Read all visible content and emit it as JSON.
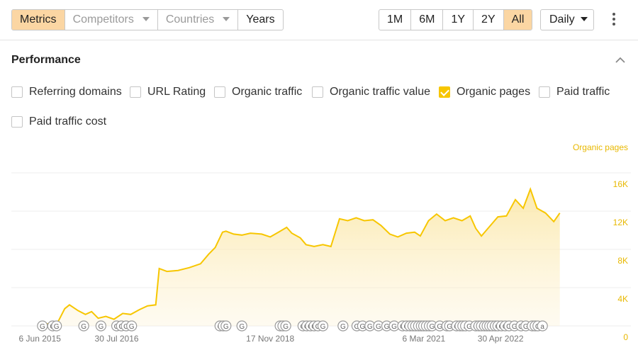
{
  "toolbar": {
    "tabs": [
      {
        "label": "Metrics",
        "state": "active"
      },
      {
        "label": "Competitors",
        "state": "disabled",
        "dropdown": true
      },
      {
        "label": "Countries",
        "state": "disabled",
        "dropdown": true
      },
      {
        "label": "Years",
        "state": "normal"
      }
    ],
    "ranges": [
      {
        "label": "1M",
        "active": false
      },
      {
        "label": "6M",
        "active": false
      },
      {
        "label": "1Y",
        "active": false
      },
      {
        "label": "2Y",
        "active": false
      },
      {
        "label": "All",
        "active": true
      }
    ],
    "interval": "Daily"
  },
  "performance": {
    "title": "Performance",
    "metrics": [
      {
        "label": "Referring domains",
        "checked": false
      },
      {
        "label": "URL Rating",
        "checked": false
      },
      {
        "label": "Organic traffic",
        "checked": false
      },
      {
        "label": "Organic traffic value",
        "checked": false
      },
      {
        "label": "Organic pages",
        "checked": true
      },
      {
        "label": "Paid traffic",
        "checked": false
      },
      {
        "label": "Paid traffic cost",
        "checked": false
      }
    ]
  },
  "colors": {
    "accent": "#f7c600",
    "active_tab": "#fbd6a3",
    "axis_label": "#e8b800"
  },
  "chart_data": {
    "type": "area",
    "series_name": "Organic pages",
    "y_ticks": [
      "16K",
      "12K",
      "8K",
      "4K",
      "0"
    ],
    "x_ticks": [
      "6 Jun 2015",
      "30 Jul 2016",
      "17 Nov 2018",
      "6 Mar 2021",
      "30 Apr 2022"
    ],
    "ylim": [
      0,
      16000
    ],
    "x_range": [
      "2015-01-01",
      "2023-10-01"
    ],
    "grid": true,
    "points": [
      [
        "2015-06-01",
        0
      ],
      [
        "2015-07-15",
        200
      ],
      [
        "2015-09-15",
        500
      ],
      [
        "2015-10-20",
        1800
      ],
      [
        "2015-11-15",
        2200
      ],
      [
        "2016-01-01",
        1600
      ],
      [
        "2016-02-10",
        1200
      ],
      [
        "2016-03-15",
        1500
      ],
      [
        "2016-04-20",
        800
      ],
      [
        "2016-06-01",
        1000
      ],
      [
        "2016-07-15",
        700
      ],
      [
        "2016-09-01",
        1300
      ],
      [
        "2016-10-15",
        1200
      ],
      [
        "2016-12-01",
        1700
      ],
      [
        "2017-01-15",
        2100
      ],
      [
        "2017-03-01",
        2200
      ],
      [
        "2017-03-20",
        6000
      ],
      [
        "2017-05-01",
        5700
      ],
      [
        "2017-07-01",
        5800
      ],
      [
        "2017-09-01",
        6100
      ],
      [
        "2017-11-01",
        6500
      ],
      [
        "2017-12-15",
        7500
      ],
      [
        "2018-01-20",
        8200
      ],
      [
        "2018-03-01",
        9800
      ],
      [
        "2018-03-20",
        9900
      ],
      [
        "2018-05-01",
        9600
      ],
      [
        "2018-06-15",
        9500
      ],
      [
        "2018-08-01",
        9700
      ],
      [
        "2018-10-01",
        9600
      ],
      [
        "2018-11-17",
        9300
      ],
      [
        "2019-01-01",
        9800
      ],
      [
        "2019-02-15",
        10300
      ],
      [
        "2019-03-15",
        9700
      ],
      [
        "2019-05-01",
        9200
      ],
      [
        "2019-06-01",
        8500
      ],
      [
        "2019-07-15",
        8300
      ],
      [
        "2019-09-01",
        8500
      ],
      [
        "2019-10-15",
        8300
      ],
      [
        "2019-12-01",
        11200
      ],
      [
        "2020-01-15",
        11000
      ],
      [
        "2020-03-01",
        11300
      ],
      [
        "2020-04-15",
        11000
      ],
      [
        "2020-06-01",
        11100
      ],
      [
        "2020-07-15",
        10500
      ],
      [
        "2020-09-01",
        9600
      ],
      [
        "2020-10-15",
        9300
      ],
      [
        "2020-12-01",
        9700
      ],
      [
        "2021-01-15",
        9800
      ],
      [
        "2021-02-15",
        9400
      ],
      [
        "2021-04-01",
        11000
      ],
      [
        "2021-05-15",
        11700
      ],
      [
        "2021-07-01",
        11000
      ],
      [
        "2021-08-15",
        11300
      ],
      [
        "2021-10-01",
        11000
      ],
      [
        "2021-11-15",
        11500
      ],
      [
        "2021-12-15",
        10200
      ],
      [
        "2022-01-15",
        9400
      ],
      [
        "2022-03-01",
        10400
      ],
      [
        "2022-04-15",
        11400
      ],
      [
        "2022-06-01",
        11500
      ],
      [
        "2022-07-20",
        13200
      ],
      [
        "2022-09-01",
        12300
      ],
      [
        "2022-10-10",
        14300
      ],
      [
        "2022-11-15",
        12300
      ],
      [
        "2023-01-01",
        11800
      ],
      [
        "2023-02-15",
        10900
      ],
      [
        "2023-03-20",
        11800
      ]
    ],
    "annotation_labels": [
      "G",
      "G",
      "G",
      "G",
      "G",
      "G",
      "G",
      "G",
      "G",
      "G",
      "G",
      "G",
      "G",
      "G",
      "G",
      "G",
      "G",
      "G",
      "G",
      "G",
      "G",
      "G",
      "G",
      "G",
      "G",
      "G",
      "G",
      "G",
      "G",
      "G",
      "G",
      "G",
      "G",
      "G",
      "G",
      "G",
      "G",
      "G",
      "G",
      "G",
      "G",
      "G",
      "G",
      "G",
      "G",
      "G",
      "a",
      "G",
      "G",
      "G",
      "G",
      "G",
      "G",
      "G",
      "G",
      "G",
      "G",
      "G",
      "G",
      "G",
      "G",
      "G",
      "G",
      "G",
      "G",
      "G",
      "a"
    ],
    "annotations": [
      "2015-06-20",
      "2015-08-15",
      "2015-09-05",
      "2016-02-01",
      "2016-05-05",
      "2016-07-30",
      "2016-08-25",
      "2016-09-20",
      "2016-10-20",
      "2018-02-15",
      "2018-03-05",
      "2018-03-20",
      "2018-06-15",
      "2019-01-10",
      "2019-01-25",
      "2019-02-10",
      "2019-05-15",
      "2019-06-05",
      "2019-06-25",
      "2019-07-15",
      "2019-08-05",
      "2019-09-01",
      "2019-12-20",
      "2020-03-05",
      "2020-04-05",
      "2020-05-15",
      "2020-07-01",
      "2020-08-15",
      "2020-09-25",
      "2020-11-10",
      "2020-12-01",
      "2020-12-20",
      "2021-01-05",
      "2021-01-20",
      "2021-02-05",
      "2021-02-20",
      "2021-03-05",
      "2021-03-20",
      "2021-04-05",
      "2021-04-20",
      "2021-06-01",
      "2021-07-10",
      "2021-07-25",
      "2021-09-01",
      "2021-09-20",
      "2021-10-05",
      "2021-10-20",
      "2021-11-10",
      "2021-12-15",
      "2022-01-01",
      "2022-01-15",
      "2022-02-01",
      "2022-02-15",
      "2022-03-01",
      "2022-03-15",
      "2022-04-01",
      "2022-04-15",
      "2022-05-05",
      "2022-05-25",
      "2022-06-15",
      "2022-07-15",
      "2022-08-20",
      "2022-09-15",
      "2022-10-20",
      "2022-11-05",
      "2022-11-20",
      "2022-12-15"
    ]
  }
}
